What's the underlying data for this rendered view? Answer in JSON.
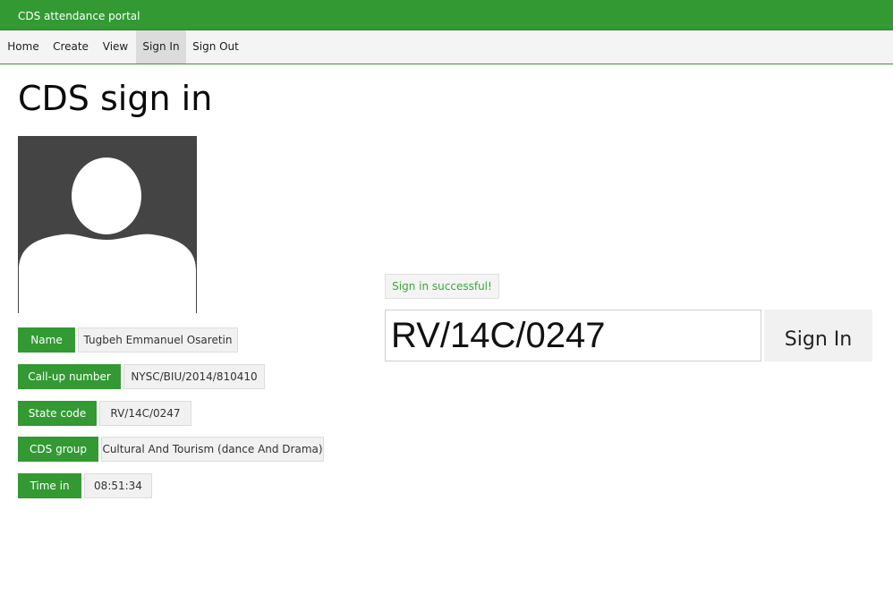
{
  "app": {
    "title": "CDS attendance portal"
  },
  "nav": {
    "items": [
      {
        "label": "Home"
      },
      {
        "label": "Create"
      },
      {
        "label": "View"
      },
      {
        "label": "Sign In",
        "active": true
      },
      {
        "label": "Sign Out"
      }
    ]
  },
  "page": {
    "title": "CDS sign in"
  },
  "avatar": {
    "icon": "user-silhouette-icon"
  },
  "details": {
    "name": {
      "label": "Name",
      "value": "Tugbeh Emmanuel Osaretin"
    },
    "callup": {
      "label": "Call-up number",
      "value": "NYSC/BIU/2014/810410"
    },
    "state_code": {
      "label": "State code",
      "value": "RV/14C/0247"
    },
    "cds_group": {
      "label": "CDS group",
      "value": "Cultural And Tourism (dance And Drama)"
    },
    "time_in": {
      "label": "Time in",
      "value": "08:51:34"
    }
  },
  "signin_form": {
    "status_message": "Sign in successful!",
    "code_value": "RV/14C/0247",
    "button_label": "Sign In"
  },
  "colors": {
    "accent": "#339933",
    "success_text": "#3aa83a",
    "avatar_bg": "#444444"
  }
}
